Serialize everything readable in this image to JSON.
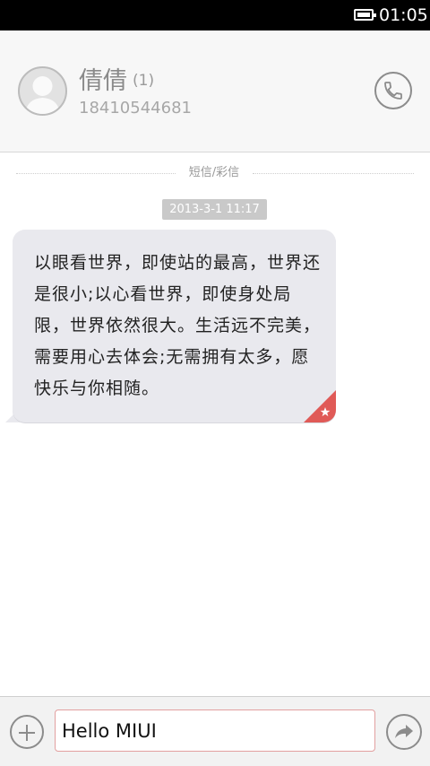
{
  "status_bar": {
    "time": "01:05"
  },
  "contact": {
    "name": "倩倩",
    "count": "(1)",
    "phone": "18410544681",
    "avatar_icon": "person-silhouette-icon",
    "call_icon": "phone-icon"
  },
  "thread": {
    "type_label": "短信/彩信",
    "timestamp": "2013-3-1 11:17",
    "message": {
      "text": "以眼看世界，即使站的最高，世界还是很小;以心看世界，即使身处局限，世界依然很大。生活远不完美，需要用心去体会;无需拥有太多，愿快乐与你相随。",
      "badge_icon": "star-icon",
      "badge_color": "#e05a57"
    }
  },
  "composer": {
    "attach_icon": "plus-icon",
    "input_value": "Hello MIUI",
    "send_icon": "send-arrow-icon"
  }
}
